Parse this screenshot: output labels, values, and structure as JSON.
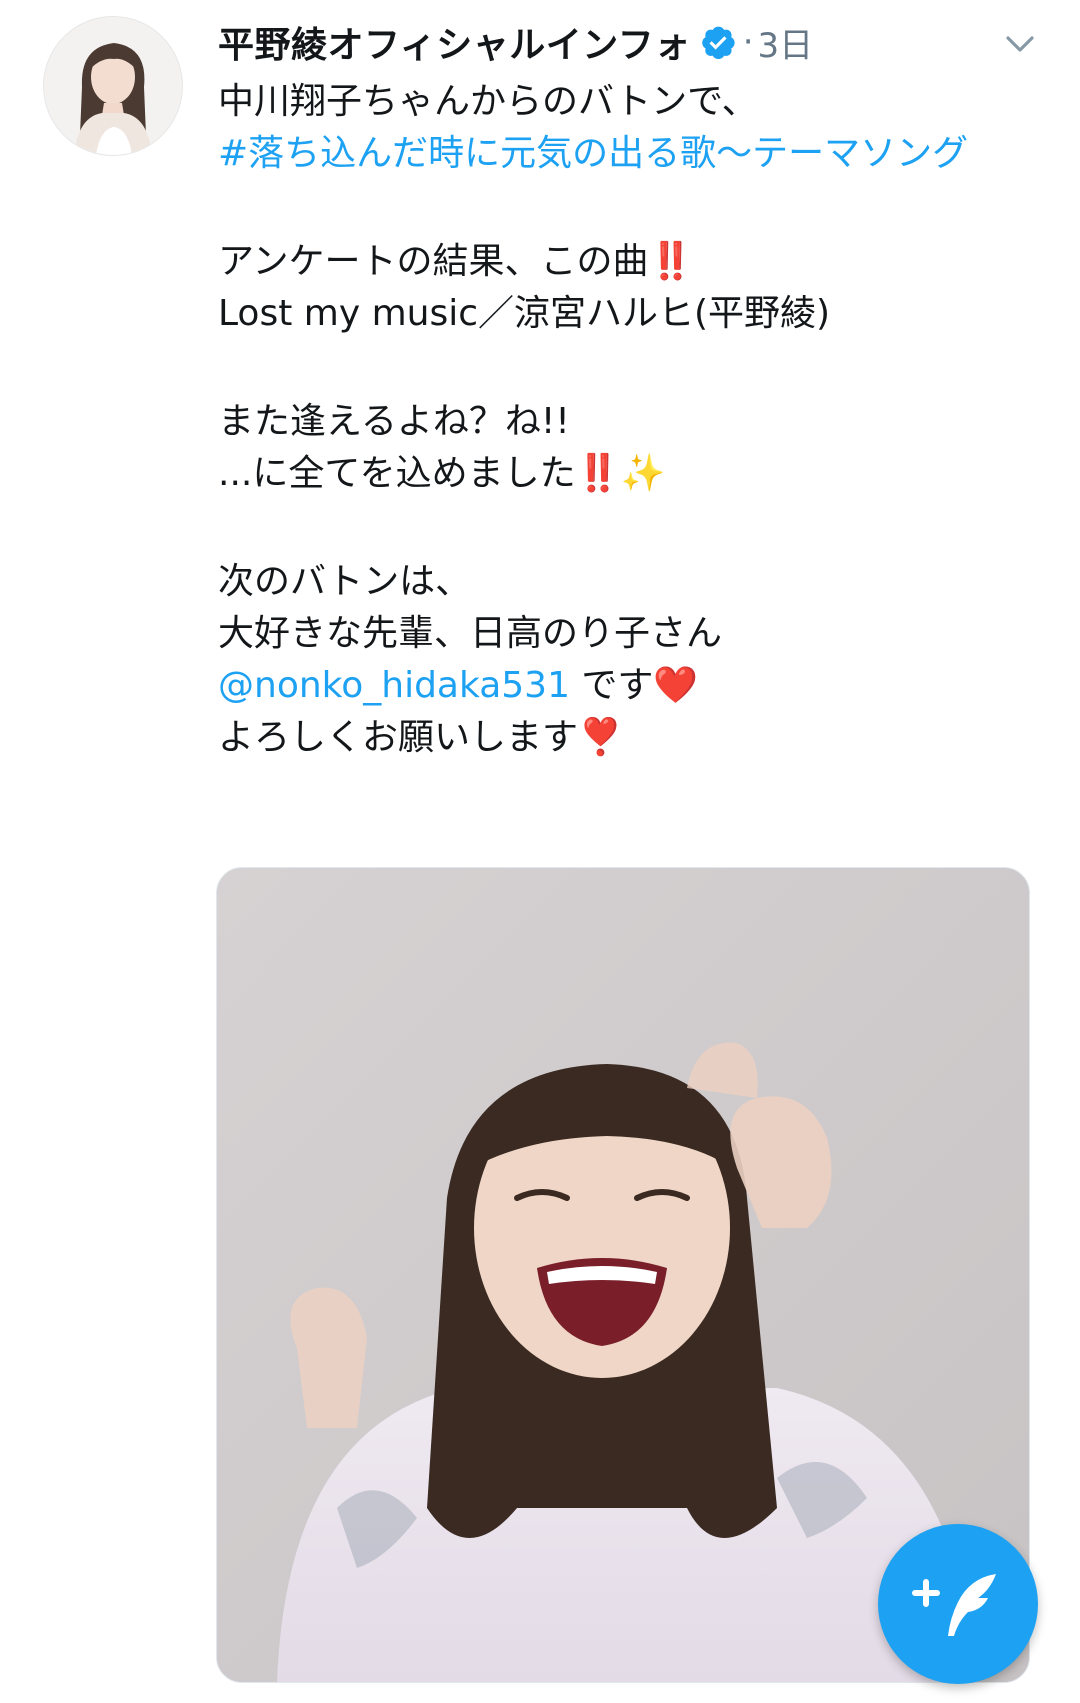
{
  "tweet": {
    "author_name": "平野綾オフィシャルインフォ",
    "separator": "·",
    "timestamp": "3日",
    "lines": {
      "l1": "中川翔子ちゃんからのバトンで、",
      "hashtag": "#落ち込んだ時に元気の出る歌〜テーマソング",
      "l3": "アンケートの結果、この曲",
      "l3_emoji": "‼️",
      "l4": "Lost my music／涼宮ハルヒ(平野綾)",
      "l5": "また逢えるよね？ね!!",
      "l6": "...に全てを込めました",
      "l6_emoji": "‼️",
      "l6_emoji2": "✨",
      "l7": "次のバトンは、",
      "l8": "大好きな先輩、日高のり子さん",
      "mention": "@nonko_hidaka531",
      "l9_suffix": " です",
      "l9_emoji": "❤️",
      "l10": "よろしくお願いします",
      "l10_emoji": "❣️"
    }
  },
  "icons": {
    "verified": "verified-badge-icon",
    "caret": "chevron-down-icon",
    "compose": "compose-tweet-icon"
  },
  "colors": {
    "link": "#1da1f2",
    "secondary_text": "#657786",
    "fab": "#1da1f2"
  }
}
